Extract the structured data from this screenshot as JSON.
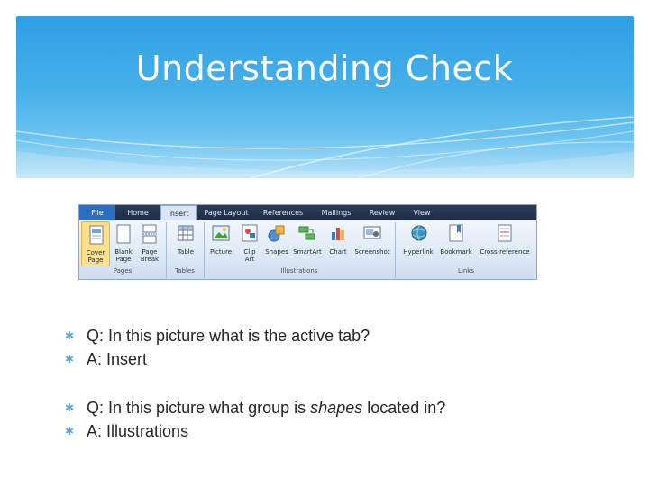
{
  "slide": {
    "title": "Understanding Check"
  },
  "ribbon": {
    "tabs": [
      "File",
      "Home",
      "Insert",
      "Page Layout",
      "References",
      "Mailings",
      "Review",
      "View"
    ],
    "active_tab": "Insert",
    "commands": {
      "cover_page_1": "Cover",
      "cover_page_2": "Page",
      "blank_page_1": "Blank",
      "blank_page_2": "Page",
      "page_break_1": "Page",
      "page_break_2": "Break",
      "table": "Table",
      "picture": "Picture",
      "clip_art_1": "Clip",
      "clip_art_2": "Art",
      "shapes": "Shapes",
      "smartart": "SmartArt",
      "chart": "Chart",
      "screenshot": "Screenshot",
      "hyperlink": "Hyperlink",
      "bookmark": "Bookmark",
      "cross_reference": "Cross-reference"
    },
    "groups": {
      "pages": "Pages",
      "tables": "Tables",
      "illustrations": "Illustrations",
      "links": "Links"
    }
  },
  "qa": {
    "q1_label": "Q:",
    "q1_text": "In this picture what is the active tab?",
    "a1_label": "A:",
    "a1_text": "Insert",
    "q2_label": "Q:",
    "q2_text_before": "In this picture what group is",
    "q2_text_em": "shapes",
    "q2_text_after": "located in?",
    "a2_label": "A:",
    "a2_text": "Illustrations"
  },
  "colors": {
    "banner_top": "#2f9fe4",
    "banner_bottom": "#b9e2f8",
    "bullet": "#5aa7d8",
    "body_text": "#262626"
  }
}
